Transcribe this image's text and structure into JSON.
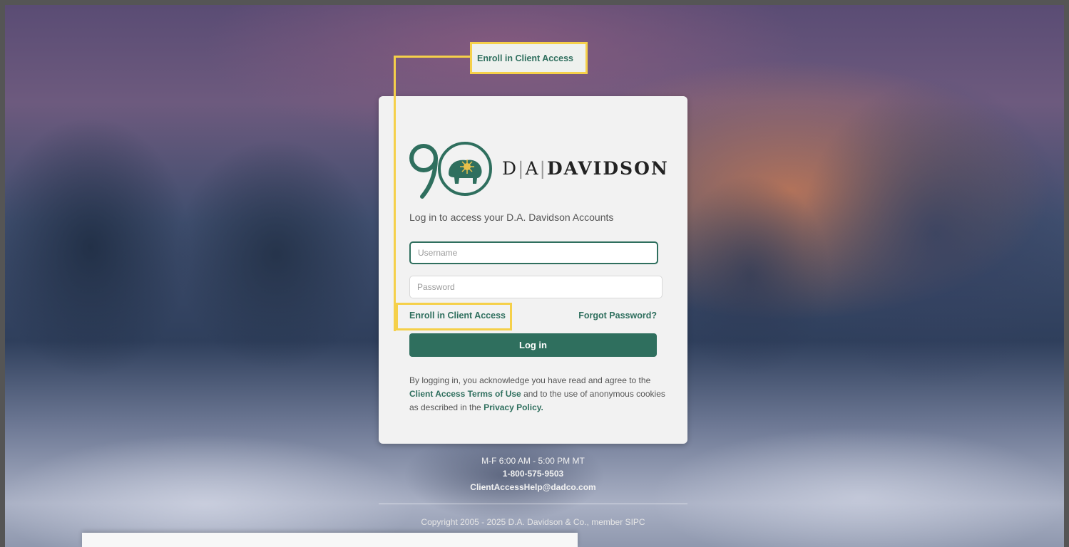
{
  "brand": {
    "mark_number": "90",
    "wordmark_left": "D",
    "wordmark_mid": "A",
    "wordmark_right": "DAVIDSON",
    "primary_color": "#2f6f5e",
    "callout_color": "#f5d04a"
  },
  "login": {
    "subtitle": "Log in to access your D.A. Davidson Accounts",
    "username_placeholder": "Username",
    "password_placeholder": "Password",
    "enroll_label": "Enroll in Client Access",
    "forgot_label": "Forgot Password?",
    "login_button": "Log in"
  },
  "legal": {
    "text_1": "By logging in, you acknowledge you have read and agree to the ",
    "terms_link": "Client Access Terms of Use",
    "text_2": " and to the use of anonymous cookies as described in the ",
    "privacy_link": "Privacy Policy."
  },
  "contact": {
    "hours": "M-F 6:00 AM - 5:00 PM MT",
    "phone": "1-800-575-9503",
    "email": "ClientAccessHelp@dadco.com"
  },
  "footer": {
    "copyright": "Copyright 2005 - 2025    D.A. Davidson & Co., member SIPC"
  },
  "callout": {
    "label": "Enroll in Client Access"
  }
}
